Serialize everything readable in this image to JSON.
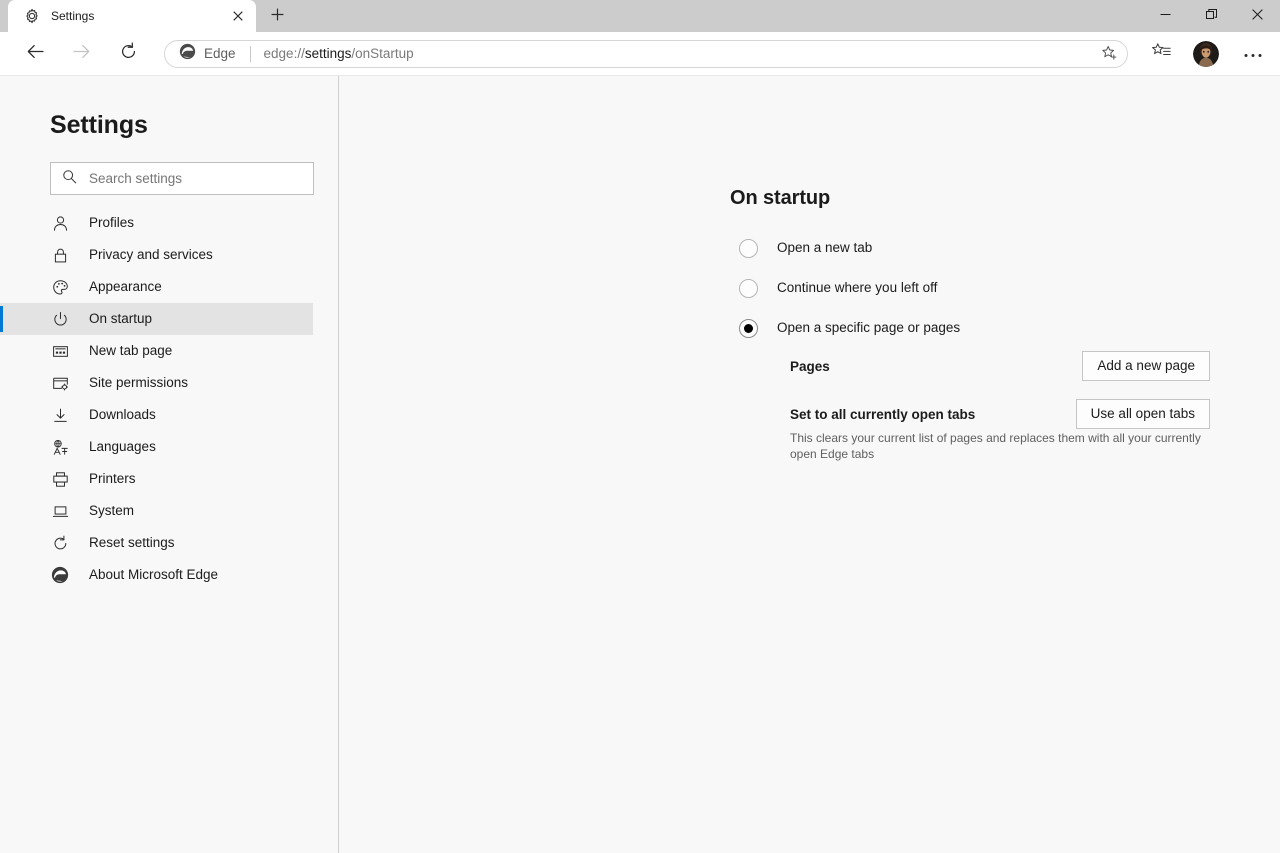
{
  "window": {
    "tab": {
      "title": "Settings",
      "favicon_icon": "gear-icon",
      "close_icon": "close-icon"
    },
    "new_tab_icon": "plus-icon",
    "controls": {
      "minimize_icon": "minimize-icon",
      "restore_icon": "restore-icon",
      "close_icon": "close-icon"
    }
  },
  "toolbar": {
    "back_icon": "back-arrow-icon",
    "forward_icon": "forward-arrow-icon",
    "reload_icon": "reload-icon",
    "omnibox": {
      "brand_icon": "edge-logo-icon",
      "brand_label": "Edge",
      "url_prefix": "edge://",
      "url_strong": "settings",
      "url_suffix": "/onStartup",
      "url_full": "edge://settings/onStartup",
      "star_icon": "favorites-star-icon"
    },
    "collections_icon": "collections-icon",
    "profile_icon": "profile-avatar",
    "more_icon": "more-ellipsis-icon"
  },
  "sidebar": {
    "heading": "Settings",
    "search": {
      "placeholder": "Search settings",
      "value": "",
      "icon": "search-icon"
    },
    "items": [
      {
        "label": "Profiles",
        "icon": "person-icon",
        "active": false
      },
      {
        "label": "Privacy and services",
        "icon": "lock-icon",
        "active": false
      },
      {
        "label": "Appearance",
        "icon": "palette-icon",
        "active": false
      },
      {
        "label": "On startup",
        "icon": "power-icon",
        "active": true
      },
      {
        "label": "New tab page",
        "icon": "new-tab-page-icon",
        "active": false
      },
      {
        "label": "Site permissions",
        "icon": "site-permissions-icon",
        "active": false
      },
      {
        "label": "Downloads",
        "icon": "download-arrow-icon",
        "active": false
      },
      {
        "label": "Languages",
        "icon": "languages-icon",
        "active": false
      },
      {
        "label": "Printers",
        "icon": "printer-icon",
        "active": false
      },
      {
        "label": "System",
        "icon": "laptop-icon",
        "active": false
      },
      {
        "label": "Reset settings",
        "icon": "reset-circle-icon",
        "active": false
      },
      {
        "label": "About Microsoft Edge",
        "icon": "edge-logo-icon",
        "active": false
      }
    ]
  },
  "main": {
    "title": "On startup",
    "options": [
      {
        "label": "Open a new tab",
        "selected": false
      },
      {
        "label": "Continue where you left off",
        "selected": false
      },
      {
        "label": "Open a specific page or pages",
        "selected": true
      }
    ],
    "sections": [
      {
        "title": "Pages",
        "description": "",
        "button": "Add a new page"
      },
      {
        "title": "Set to all currently open tabs",
        "description": "This clears your current list of pages and replaces them with all your currently open Edge tabs",
        "button": "Use all open tabs"
      }
    ]
  },
  "colors": {
    "accent": "#0078d4",
    "titlebar": "#cccccc",
    "page_bg": "#f8f8f8",
    "active_item_bg": "#e3e3e3"
  }
}
